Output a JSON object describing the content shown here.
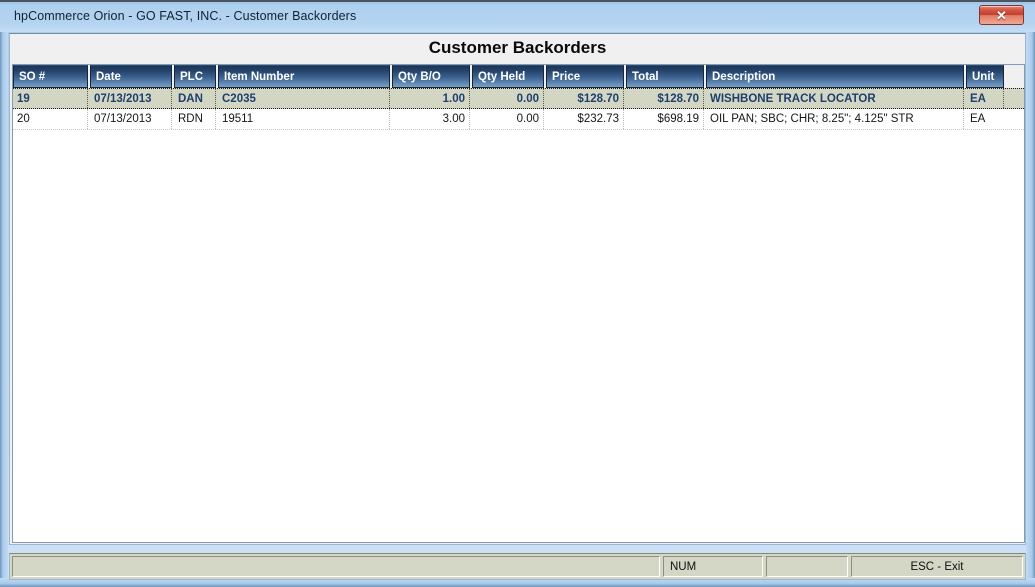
{
  "window": {
    "title": "hpCommerce Orion - GO FAST, INC. - Customer Backorders",
    "close_label": "✕",
    "close_icon": "close-icon",
    "accent_color": "#1c3557",
    "selection_color": "#d3d6c3",
    "titlebar_color": "#aed0f0"
  },
  "page": {
    "title": "Customer Backorders"
  },
  "grid": {
    "columns": [
      {
        "key": "so",
        "label": "SO #"
      },
      {
        "key": "date",
        "label": "Date"
      },
      {
        "key": "plc",
        "label": "PLC"
      },
      {
        "key": "item",
        "label": "Item Number"
      },
      {
        "key": "qtybo",
        "label": "Qty B/O"
      },
      {
        "key": "qtyh",
        "label": "Qty Held"
      },
      {
        "key": "price",
        "label": "Price"
      },
      {
        "key": "total",
        "label": "Total"
      },
      {
        "key": "desc",
        "label": "Description"
      },
      {
        "key": "unit",
        "label": "Unit"
      }
    ],
    "rows": [
      {
        "selected": true,
        "so": "19",
        "date": "07/13/2013",
        "plc": "DAN",
        "item": "C2035",
        "qtybo": "1.00",
        "qtyh": "0.00",
        "price": "$128.70",
        "total": "$128.70",
        "desc": "WISHBONE TRACK LOCATOR",
        "unit": "EA"
      },
      {
        "selected": false,
        "so": "20",
        "date": "07/13/2013",
        "plc": "RDN",
        "item": "19511",
        "qtybo": "3.00",
        "qtyh": "0.00",
        "price": "$232.73",
        "total": "$698.19",
        "desc": "OIL PAN; SBC; CHR; 8.25\"; 4.125\" STR",
        "unit": "EA"
      }
    ]
  },
  "statusbar": {
    "main": "",
    "num": "NUM",
    "middle": "",
    "esc": "ESC - Exit"
  }
}
